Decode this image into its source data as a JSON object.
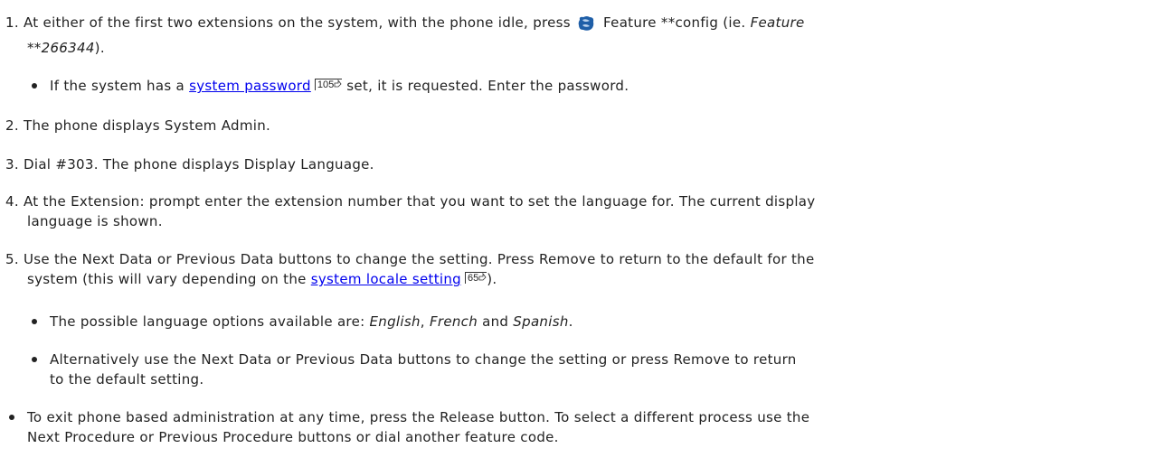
{
  "steps": {
    "s1": {
      "num": "1.",
      "line1_pre": "At either of the first two extensions on the system, with the phone idle, press ",
      "line1_mid": " Feature **config (ie. ",
      "line1_em": "Feature",
      "line2_em": "**266344",
      "line2_post": ")."
    },
    "s1_bullet": {
      "pre": "If the system has a ",
      "link": "system password",
      "ref": "105",
      "post": " set, it is requested. Enter the password."
    },
    "s2": {
      "num": "2.",
      "text": "The phone displays System Admin."
    },
    "s3": {
      "num": "3.",
      "text": "Dial #303. The phone displays Display Language."
    },
    "s4": {
      "num": "4.",
      "line1": "At the Extension: prompt enter the extension number that you want to set the language for. The current display",
      "line2": "language is shown."
    },
    "s5": {
      "num": "5.",
      "line1": "Use the Next Data or Previous Data buttons to change the setting. Press Remove to return to the default for the",
      "line2_pre": "system (this will vary depending on the ",
      "link": "system locale setting",
      "ref": "65",
      "line2_post": ")."
    },
    "s5_bullet1": {
      "pre": "The possible language options available are: ",
      "em1": "English",
      "sep1": ", ",
      "em2": "French",
      "sep2": " and ",
      "em3": "Spanish",
      "post": "."
    },
    "s5_bullet2": {
      "line1": "Alternatively use the Next Data or Previous Data buttons to change the setting or press Remove to return",
      "line2": "to the default setting."
    },
    "final_bullet": {
      "line1": "To exit phone based administration at any time, press the Release button. To select a different process use the",
      "line2": "Next Procedure or Previous Procedure buttons or dial another feature code."
    }
  },
  "icons": {
    "feature": "feature-button-icon",
    "ref_arrow": "cross-reference-arrow-icon"
  },
  "colors": {
    "text": "#222222",
    "link": "#0000ee",
    "icon_blue": "#1f5fa8"
  }
}
